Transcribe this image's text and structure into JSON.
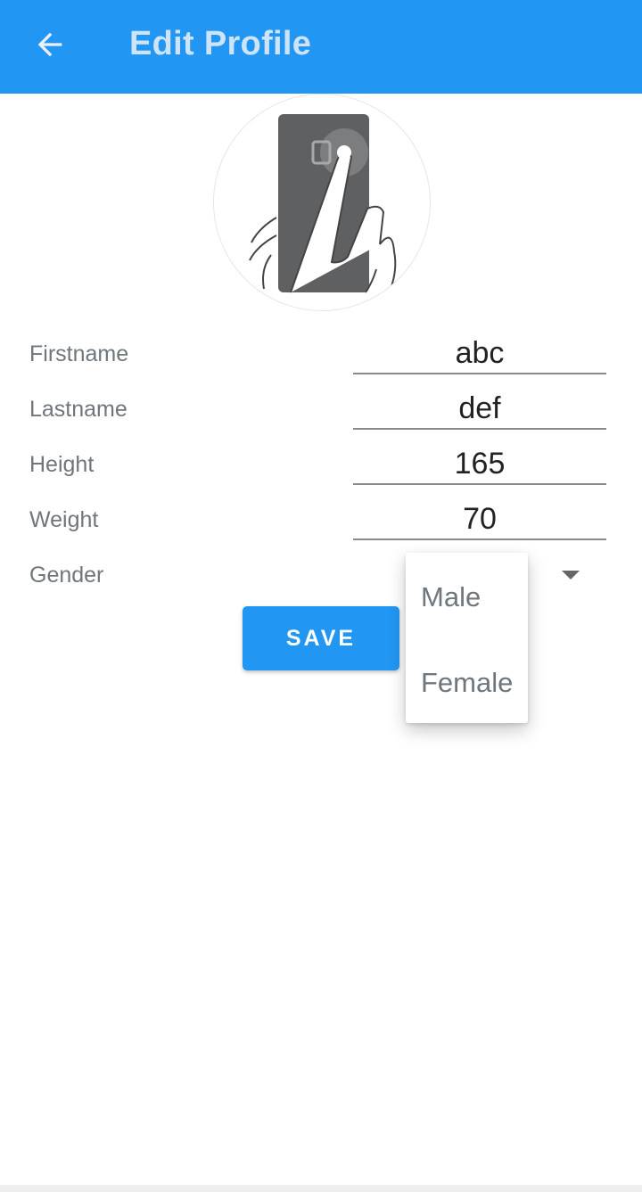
{
  "app_bar": {
    "title": "Edit Profile",
    "back_icon": "arrow-left-icon",
    "color": "#2196F3"
  },
  "avatar": {
    "icon": "phone-tap-illustration"
  },
  "form": {
    "firstname": {
      "label": "Firstname",
      "value": "abc"
    },
    "lastname": {
      "label": "Lastname",
      "value": "def"
    },
    "height": {
      "label": "Height",
      "value": "165"
    },
    "weight": {
      "label": "Weight",
      "value": "70"
    },
    "gender": {
      "label": "Gender",
      "dropdown_icon": "caret-down-icon"
    }
  },
  "save_button": {
    "label": "SAVE",
    "color": "#2196F3"
  },
  "gender_menu": {
    "options": [
      "Male",
      "Female"
    ]
  }
}
